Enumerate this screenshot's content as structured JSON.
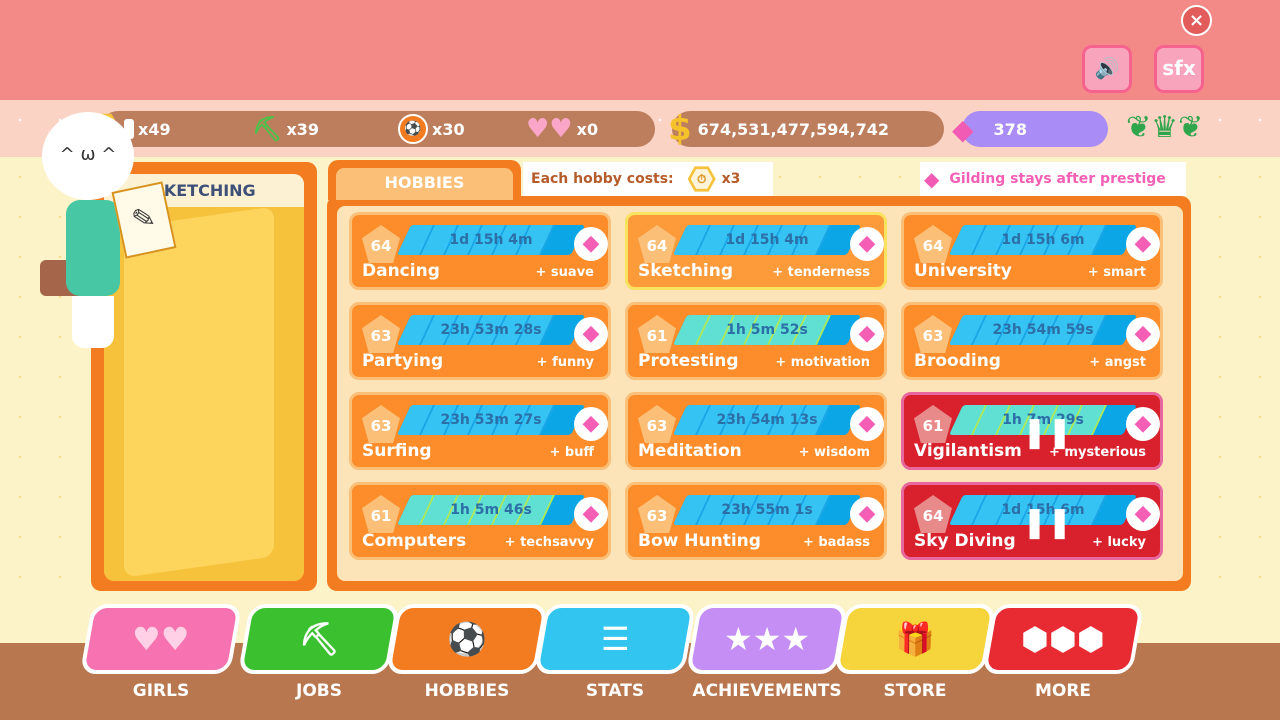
{
  "header": {
    "close_icon": "×",
    "sound_icon": "🔊",
    "sfx_label": "sfx"
  },
  "resources": {
    "timers": "x49",
    "shovels": "x39",
    "balls": "x30",
    "hearts": "x0",
    "money": "674,531,477,594,742",
    "gems": "378"
  },
  "left_panel": {
    "title": "SKETCHING"
  },
  "tabs": {
    "hobbies": "HOBBIES",
    "cost_text": "Each hobby costs:",
    "cost_value": "x3",
    "gild_text": "Gilding stays after prestige"
  },
  "hobbies": [
    {
      "level": "64",
      "name": "Dancing",
      "bonus": "+ suave",
      "time": "1d 15h 4m",
      "progress": 0.83
    },
    {
      "level": "64",
      "name": "Sketching",
      "bonus": "+ tenderness",
      "time": "1d 15h 4m",
      "progress": 0.83
    },
    {
      "level": "64",
      "name": "University",
      "bonus": "+ smart",
      "time": "1d 15h 6m",
      "progress": 0.83
    },
    {
      "level": "63",
      "name": "Partying",
      "bonus": "+ funny",
      "time": "23h 53m 28s",
      "progress": 0.83
    },
    {
      "level": "61",
      "name": "Protesting",
      "bonus": "+ motivation",
      "time": "1h 5m 52s",
      "progress": 0.83
    },
    {
      "level": "63",
      "name": "Brooding",
      "bonus": "+ angst",
      "time": "23h 54m 59s",
      "progress": 0.83
    },
    {
      "level": "63",
      "name": "Surfing",
      "bonus": "+ buff",
      "time": "23h 53m 27s",
      "progress": 0.83
    },
    {
      "level": "63",
      "name": "Meditation",
      "bonus": "+ wisdom",
      "time": "23h 54m 13s",
      "progress": 0.83
    },
    {
      "level": "61",
      "name": "Vigilantism",
      "bonus": "+ mysterious",
      "time": "1h 7m 29s",
      "progress": 0.83,
      "paused": true
    },
    {
      "level": "61",
      "name": "Computers",
      "bonus": "+ techsavvy",
      "time": "1h 5m 46s",
      "progress": 0.83
    },
    {
      "level": "63",
      "name": "Bow Hunting",
      "bonus": "+ badass",
      "time": "23h 55m 1s",
      "progress": 0.83
    },
    {
      "level": "64",
      "name": "Sky Diving",
      "bonus": "+ lucky",
      "time": "1d 15h 6m",
      "progress": 0.83,
      "paused": true
    }
  ],
  "nav": {
    "girls": "GIRLS",
    "jobs": "JOBS",
    "hobbies": "HOBBIES",
    "stats": "STATS",
    "achievements": "ACHIEVEMENTS",
    "store": "STORE",
    "more": "MORE"
  },
  "colors": {
    "top_band": "#f48a87",
    "orange": "#f47c20",
    "blue_bar": "#0aa6e6",
    "teal_bar": "#5fe0d3",
    "red_card": "#d8212c",
    "gem_pink": "#f45fb5"
  }
}
